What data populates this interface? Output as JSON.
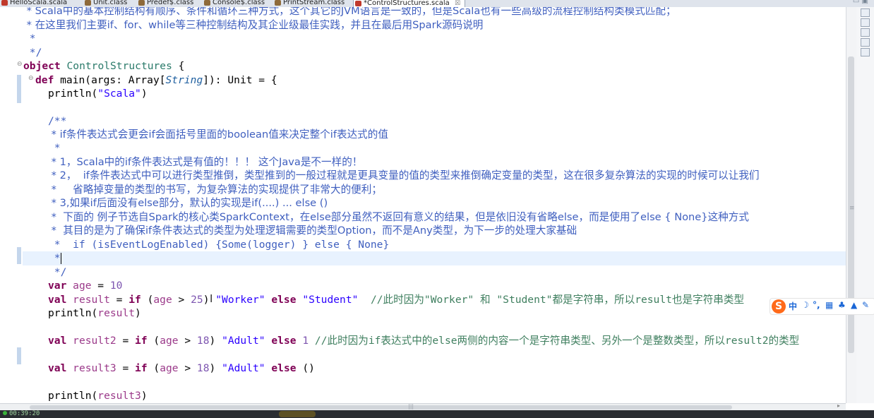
{
  "tabs": [
    {
      "label": "HelloScala.scala",
      "color": "#c0392b"
    },
    {
      "label": "Unit.class",
      "color": "#8e6a3a"
    },
    {
      "label": "Predef$.class",
      "color": "#8e6a3a"
    },
    {
      "label": "Console$.class",
      "color": "#8e6a3a"
    },
    {
      "label": "PrintStream.class",
      "color": "#8e6a3a"
    },
    {
      "label": "*ControlStructures.scala",
      "color": "#c0392b",
      "active": true
    }
  ],
  "tab_close": "☒",
  "code": {
    "l1": " * Scala中的基本控制结构有顺序、条件和循环三种方式，这个其它的JVM语言是一致的，但是Scala也有一些高级的流程控制结构类模式匹配；",
    "l2": " * 在这里我们主要if、for、while等三种控制结构及其企业级最佳实践，并且在最后用Spark源码说明",
    "l3": " *",
    "l4": " */",
    "l5_kw": "object",
    "l5_name": "ControlStructures",
    "l5_rest": " {",
    "l6_kw": "def",
    "l6_a": " main(args: Array[",
    "l6_type": "String",
    "l6_b": "]): Unit = {",
    "l7_a": "println(",
    "l7_str": "\"Scala\"",
    "l7_b": ")",
    "c1": "/**",
    "c2": " * if条件表达式会更会if会面括号里面的boolean值来决定整个if表达式的值",
    "c3": " *",
    "c4": " * 1，Scala中的if条件表达式是有值的！！！ 这个Java是不一样的！",
    "c5": " * 2，  if条件表达式中可以进行类型推倒，类型推到的一般过程就是更具变量的值的类型来推倒确定变量的类型，这在很多复杂算法的实现的时候可以让我们",
    "c6": " *     省略掉变量的类型的书写，为复杂算法的实现提供了非常大的便利；",
    "c7": " * 3,如果if后面没有else部分，默认的实现是if(....) ... else ()",
    "c8": " *  下面的 例子节选自Spark的核心类SparkContext，在else部分虽然不返回有意义的结果，但是依旧没有省略else，而是使用了else { None}这种方式",
    "c9": " *  其目的是为了确保if条件表达式的类型为处理逻辑需要的类型Option，而不是Any类型，为下一步的处理大家基础",
    "c10": " *  if (isEventLogEnabled) {Some(logger) } else { None}",
    "c11": " *",
    "c12": " */",
    "v1_kw": "var",
    "v1_name": "age",
    "v1_eq": " = ",
    "v1_num": "10",
    "v2_kw": "val",
    "v2_name": "result",
    "v2_eq": " = ",
    "v2_if": "if",
    "v2_open": " (",
    "v2_age": "age",
    "v2_gt": " > ",
    "v2_num": "25",
    "v2_close": ") ",
    "v2_s1": "\"Worker\"",
    "v2_else": "else",
    "v2_s2": "\"Student\"",
    "v2_cm": "  //此时因为\"Worker\" 和 \"Student\"都是字符串，所以result也是字符串类型",
    "p1_a": "println(",
    "p1_v": "result",
    "p1_b": ")",
    "v3_kw": "val",
    "v3_name": "result2",
    "v3_eq": " = ",
    "v3_if": "if",
    "v3_open": " (",
    "v3_age": "age",
    "v3_gt": " > ",
    "v3_num": "18",
    "v3_close": ") ",
    "v3_s1": "\"Adult\"",
    "v3_else": "else",
    "v3_n2": "1",
    "v3_cm": " //此时因为if表达式中的else两侧的内容一个是字符串类型、另外一个是整数类型，所以result2的类型",
    "v4_kw": "val",
    "v4_name": "result3",
    "v4_eq": " = ",
    "v4_if": "if",
    "v4_open": " (",
    "v4_age": "age",
    "v4_gt": " > ",
    "v4_num": "18",
    "v4_close": ") ",
    "v4_s1": "\"Adult\"",
    "v4_else": "else",
    "v4_unit": " ()",
    "p2_a": "println(",
    "p2_v": "result3",
    "p2_b": ")"
  },
  "ime": {
    "logo": "S",
    "mode": "中",
    "icons": [
      "moon-icon",
      "punct-icon",
      "keyboard-icon",
      "skin-icon",
      "shirt-icon",
      "wrench-icon"
    ]
  },
  "timer": "00:39:20"
}
